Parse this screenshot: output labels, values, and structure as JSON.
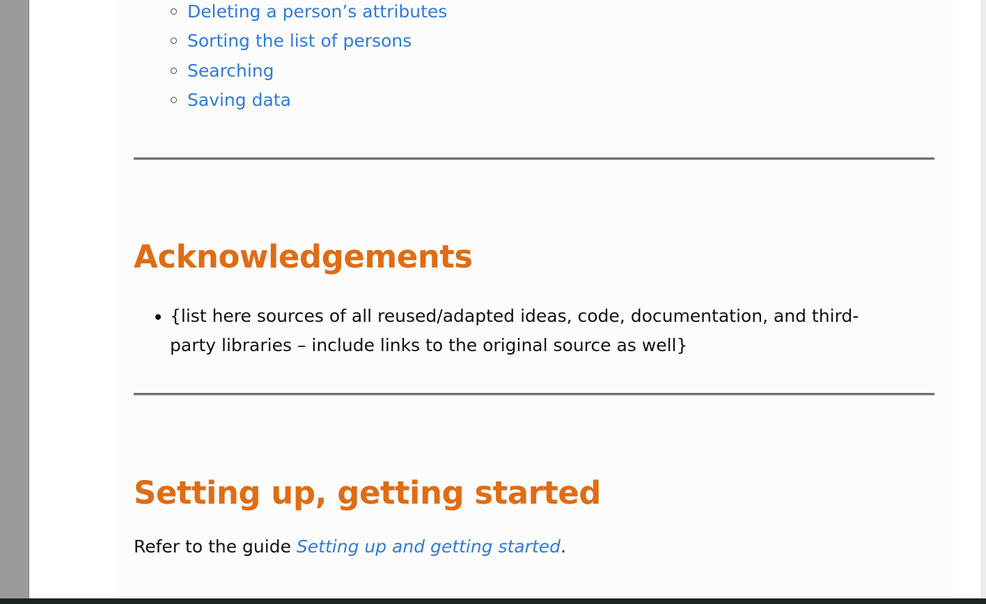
{
  "toc_sublist": [
    {
      "label": "Deleting a person’s attributes"
    },
    {
      "label": "Sorting the list of persons"
    },
    {
      "label": "Searching"
    },
    {
      "label": "Saving data"
    }
  ],
  "acknowledgements": {
    "heading": "Acknowledgements",
    "items": [
      "{list here sources of all reused/adapted ideas, code, documentation, and third-party libraries – include links to the original source as well}"
    ]
  },
  "setup": {
    "heading": "Setting up, getting started",
    "text_before": "Refer to the guide ",
    "link_text": "Setting up and getting started",
    "text_after": "."
  },
  "colors": {
    "heading": "#e06c14",
    "link": "#2f7bd8"
  }
}
